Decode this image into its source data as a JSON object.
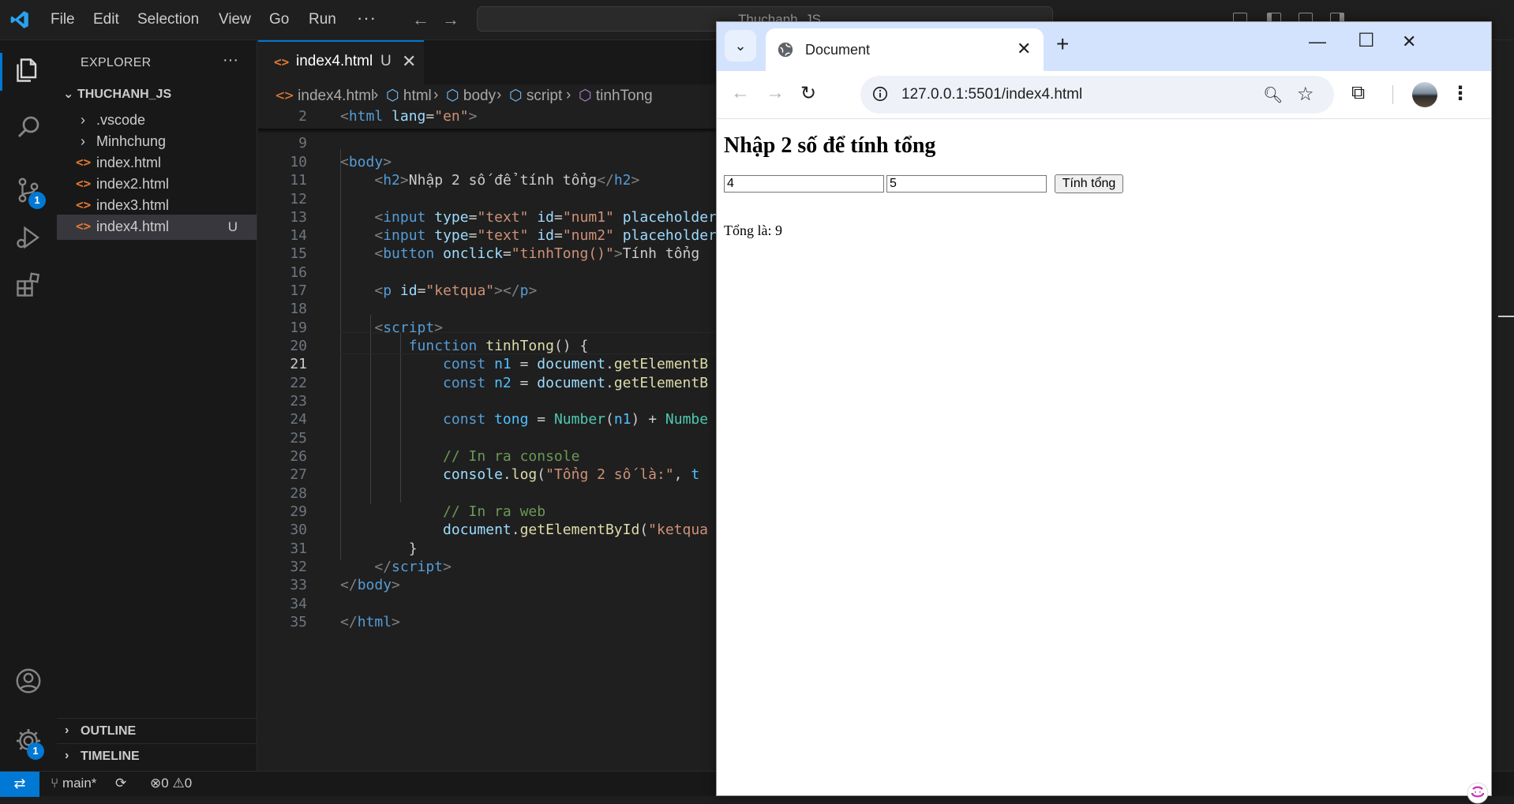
{
  "vscode": {
    "menu": [
      "File",
      "Edit",
      "Selection",
      "View",
      "Go",
      "Run"
    ],
    "menu_more": "···",
    "command_center": "Thuchanh_JS",
    "activity": {
      "source_control_badge": "1",
      "settings_badge": "1"
    },
    "explorer": {
      "title": "EXPLORER",
      "more": "···",
      "folder": "THUCHANH_JS",
      "items": [
        {
          "label": ".vscode",
          "type": "folder"
        },
        {
          "label": "Minhchung",
          "type": "folder"
        },
        {
          "label": "index.html",
          "type": "file"
        },
        {
          "label": "index2.html",
          "type": "file"
        },
        {
          "label": "index3.html",
          "type": "file"
        },
        {
          "label": "index4.html",
          "type": "file",
          "status": "U",
          "selected": true
        }
      ],
      "outline": "OUTLINE",
      "timeline": "TIMELINE"
    },
    "tab": {
      "label": "index4.html",
      "status": "U"
    },
    "breadcrumbs": [
      "index4.html",
      "html",
      "body",
      "script",
      "tinhTong"
    ],
    "line_numbers": [
      "2",
      "9",
      "10",
      "11",
      "12",
      "13",
      "14",
      "15",
      "16",
      "17",
      "18",
      "19",
      "20",
      "21",
      "22",
      "23",
      "24",
      "25",
      "26",
      "27",
      "28",
      "29",
      "30",
      "31",
      "32",
      "33",
      "34",
      "35"
    ],
    "current_line": "21",
    "status": {
      "branch": "main*",
      "errors": "0",
      "warnings": "0"
    }
  },
  "browser": {
    "tab_title": "Document",
    "url": "127.0.0.1:5501/index4.html",
    "page": {
      "heading": "Nhập 2 số để tính tổng",
      "input1_value": "4",
      "input2_value": "5",
      "button_label": "Tính tổng",
      "result": "Tổng là: 9"
    }
  },
  "colors": {
    "accent": "#0078d4",
    "html_icon": "#e37933",
    "browser_tabstrip": "#d3e3fd"
  }
}
